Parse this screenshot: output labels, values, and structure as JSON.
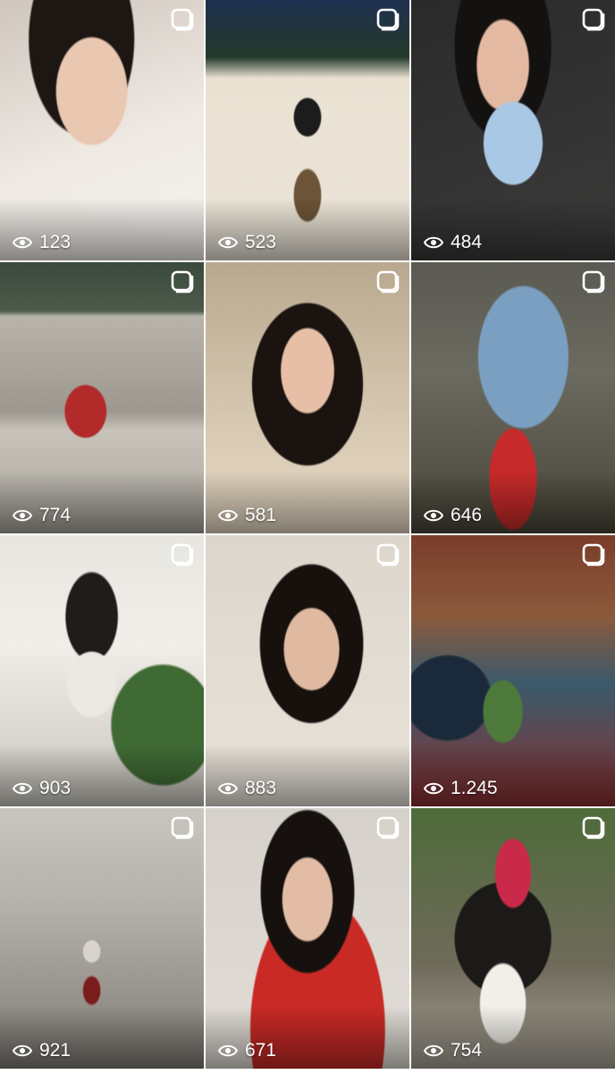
{
  "grid": {
    "tiles": [
      {
        "views": "123",
        "multiple": true
      },
      {
        "views": "523",
        "multiple": true
      },
      {
        "views": "484",
        "multiple": true
      },
      {
        "views": "774",
        "multiple": true
      },
      {
        "views": "581",
        "multiple": true
      },
      {
        "views": "646",
        "multiple": true
      },
      {
        "views": "903",
        "multiple": true
      },
      {
        "views": "883",
        "multiple": true
      },
      {
        "views": "1.245",
        "multiple": true
      },
      {
        "views": "921",
        "multiple": true
      },
      {
        "views": "671",
        "multiple": true
      },
      {
        "views": "754",
        "multiple": true
      }
    ]
  },
  "icons": {
    "views": "eye-icon",
    "multiple": "carousel-icon"
  },
  "colors": {
    "overlay_text": "#ffffff",
    "background": "#ffffff"
  }
}
